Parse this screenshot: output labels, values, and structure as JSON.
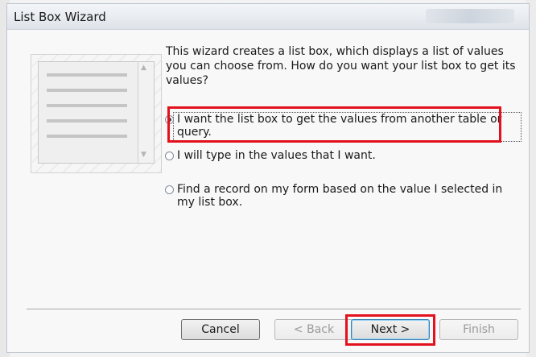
{
  "window": {
    "title": "List Box Wizard"
  },
  "intro_text": "This wizard creates a list box, which displays a list of values you can choose from.  How do you want your list box to get its values?",
  "options": [
    {
      "label": "I want the list box to get the values from another table or query.",
      "selected": true
    },
    {
      "label": "I will type in the values that I want.",
      "selected": false
    },
    {
      "label": "Find a record on my form based on the value I selected in my list box.",
      "selected": false
    }
  ],
  "buttons": {
    "cancel": "Cancel",
    "back": "< Back",
    "next": "Next >",
    "finish": "Finish"
  },
  "button_states": {
    "back_enabled": false,
    "finish_enabled": false,
    "next_default": true
  },
  "colors": {
    "annotation_highlight": "#e3101d",
    "dialog_background": "#f8f8f8"
  },
  "icons": [
    "list-box-illustration",
    "scroll-up-arrow-icon",
    "scroll-down-arrow-icon",
    "radio-button"
  ]
}
